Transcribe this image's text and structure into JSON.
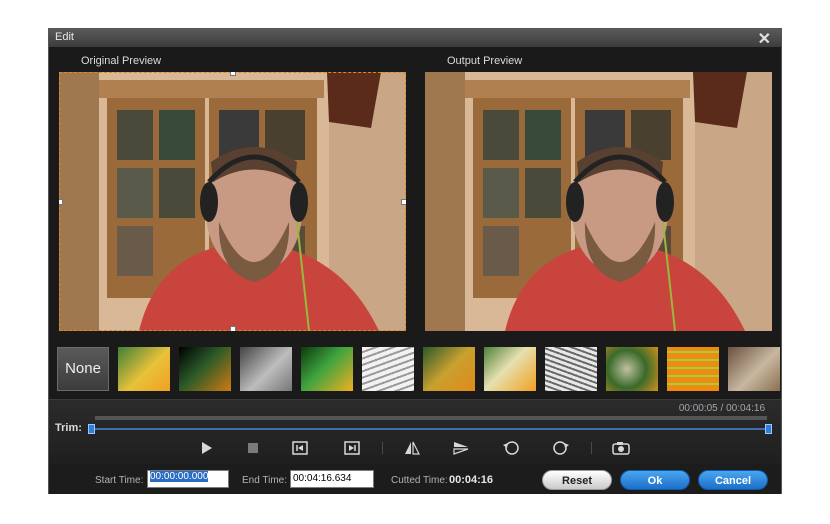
{
  "window": {
    "title": "Edit"
  },
  "panes": {
    "original_label": "Original Preview",
    "output_label": "Output Preview"
  },
  "effects": {
    "none_label": "None",
    "items": [
      "effect-1",
      "effect-2",
      "effect-3",
      "effect-4",
      "effect-5",
      "effect-6",
      "effect-7",
      "effect-8",
      "effect-9",
      "effect-10",
      "effect-11"
    ]
  },
  "timeline": {
    "time_readout": "00:00:05 / 00:04:16",
    "trim_label": "Trim:",
    "progress": 0.0
  },
  "controls": [
    "play-icon",
    "stop-icon",
    "mark-in-icon",
    "mark-out-icon",
    "flip-vertical-icon",
    "flip-horizontal-icon",
    "rotate-left-icon",
    "rotate-right-icon",
    "snapshot-icon"
  ],
  "fields": {
    "start_label": "Start Time:",
    "start_value": "00:00:00.000",
    "end_label": "End Time:",
    "end_value": "00:04:16.634",
    "cut_label": "Cutted Time:",
    "cut_value": "00:04:16"
  },
  "buttons": {
    "reset": "Reset",
    "ok": "Ok",
    "cancel": "Cancel"
  },
  "colors": {
    "selection": "#e08a1a",
    "accent": "#1c6fc8",
    "background": "#1a1a1a"
  }
}
